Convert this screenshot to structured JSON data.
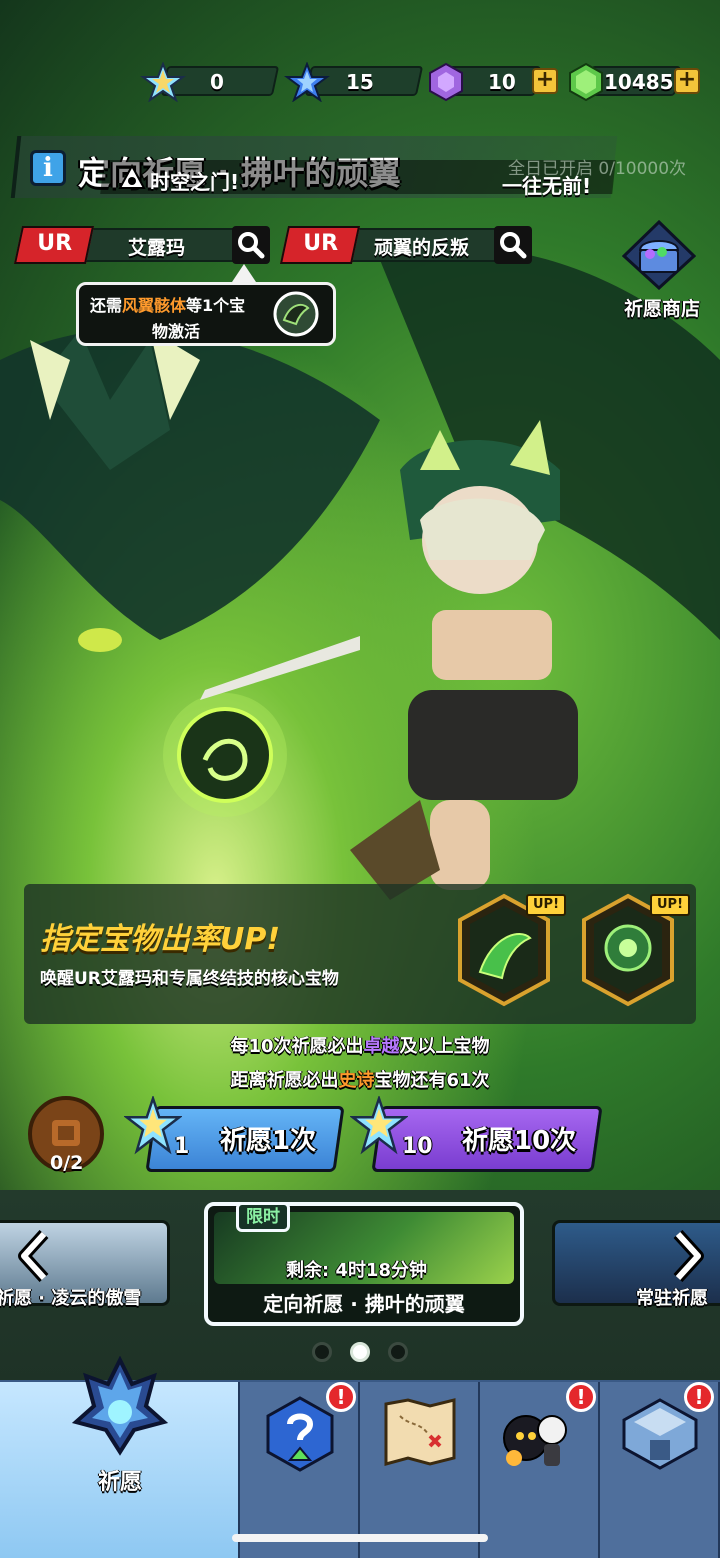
{
  "currency": {
    "star_a": "0",
    "star_b": "15",
    "crystal": "10",
    "gem": "10485",
    "plus": "+"
  },
  "banner": {
    "info_icon": "i",
    "title": "定向祈愿 · 拂叶的顽翼",
    "gate_text": "时空之门!",
    "progress": "全日已开启 0/10000次",
    "go_text": "一往无前!"
  },
  "ur_tags": [
    {
      "rarity": "UR",
      "name": "艾露玛"
    },
    {
      "rarity": "UR",
      "name": "顽翼的反叛"
    }
  ],
  "tooltip": {
    "prefix": "还需",
    "highlight": "风翼骸体",
    "suffix": "等1个宝",
    "line2": "物激活"
  },
  "shop": {
    "label": "祈愿商店"
  },
  "rate_up": {
    "title": "指定宝物出率UP!",
    "desc": "唤醒UR艾露玛和专属终结技的核心宝物",
    "badge": "UP!"
  },
  "info": {
    "line1_a": "每10次祈愿必出",
    "line1_hl": "卓越",
    "line1_b": "及以上宝物",
    "line2_a": "距离祈愿必出",
    "line2_hl": "史诗",
    "line2_b": "宝物还有61次"
  },
  "pity": {
    "count": "0/2"
  },
  "wish": {
    "single_cost": "1",
    "single_label": "祈愿1次",
    "ten_cost": "10",
    "ten_label": "祈愿10次"
  },
  "carousel": {
    "left_name": "祈愿 · 凌云的傲雪",
    "center_badge": "限时",
    "center_remain": "剩余: 4时18分钟",
    "center_name": "定向祈愿 · 拂叶的顽翼",
    "right_name": "常驻祈愿"
  },
  "nav": {
    "active_label": "祈愿",
    "alert": "!"
  },
  "colors": {
    "accent_gold": "#ffd13a",
    "ur_red": "#d6242a",
    "wish_blue": "#64b4f6",
    "wish_purple": "#a667f0",
    "highlight_orange": "#ff9a2c",
    "highlight_purple": "#b779ff"
  }
}
